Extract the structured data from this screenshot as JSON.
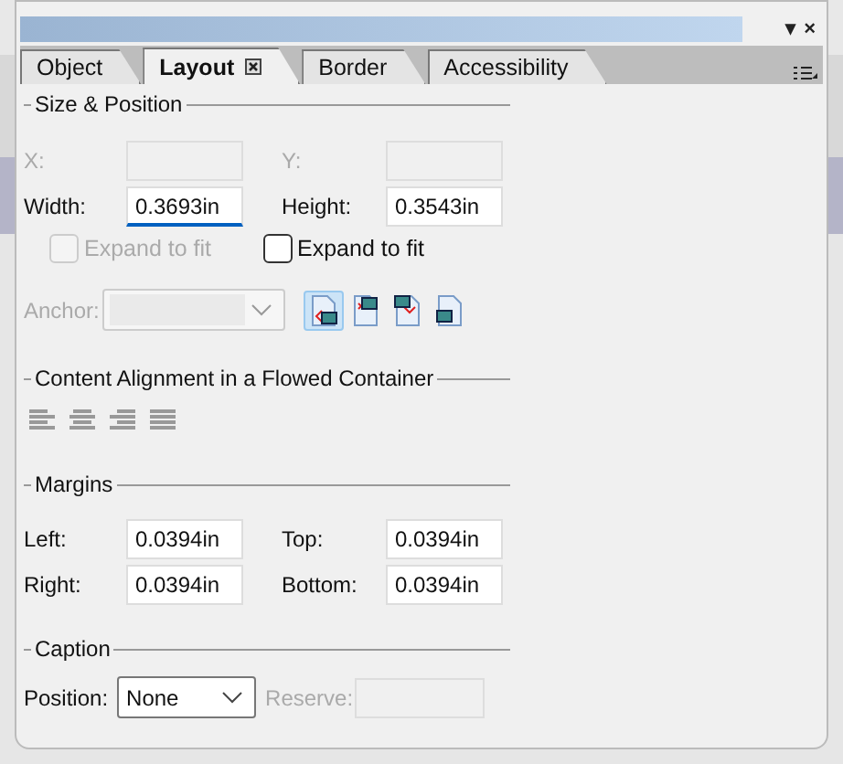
{
  "window": {
    "menu_glyph": "▾",
    "close_glyph": "×"
  },
  "tabs": [
    {
      "label": "Object",
      "selected": false,
      "closable": false
    },
    {
      "label": "Layout",
      "selected": true,
      "closable": true
    },
    {
      "label": "Border",
      "selected": false,
      "closable": false
    },
    {
      "label": "Accessibility",
      "selected": false,
      "closable": false
    }
  ],
  "size_position": {
    "title": "Size & Position",
    "fields": [
      {
        "label": "X:",
        "disabled": true,
        "focused": false
      },
      {
        "label": "Y:",
        "disabled": true,
        "focused": false
      },
      {
        "label": "Width:",
        "value": "0.3693in",
        "disabled": false,
        "focused": true
      },
      {
        "label": "Height:",
        "value": "0.3543in",
        "disabled": false,
        "focused": false
      }
    ],
    "checkboxes": [
      {
        "label": "Expand to fit",
        "checked": false,
        "disabled": true
      },
      {
        "label": "Expand to fit",
        "checked": false,
        "disabled": false
      }
    ],
    "anchor": {
      "label": "Anchor:",
      "disabled": true
    },
    "anchor_buttons": [
      {
        "selected": true
      },
      {
        "selected": false
      },
      {
        "selected": false
      },
      {
        "selected": false
      }
    ]
  },
  "content_alignment": {
    "title": "Content Alignment in a Flowed Container",
    "buttons": [
      {
        "disabled": true
      },
      {
        "disabled": true
      },
      {
        "disabled": true
      },
      {
        "disabled": true
      }
    ]
  },
  "margins": {
    "title": "Margins",
    "fields": [
      {
        "label": "Left:",
        "value": "0.0394in"
      },
      {
        "label": "Top:",
        "value": "0.0394in"
      },
      {
        "label": "Right:",
        "value": "0.0394in"
      },
      {
        "label": "Bottom:",
        "value": "0.0394in"
      }
    ]
  },
  "caption": {
    "title": "Caption",
    "position_label": "Position:",
    "position_value": "None",
    "reserve_label": "Reserve:",
    "reserve_disabled": true
  }
}
